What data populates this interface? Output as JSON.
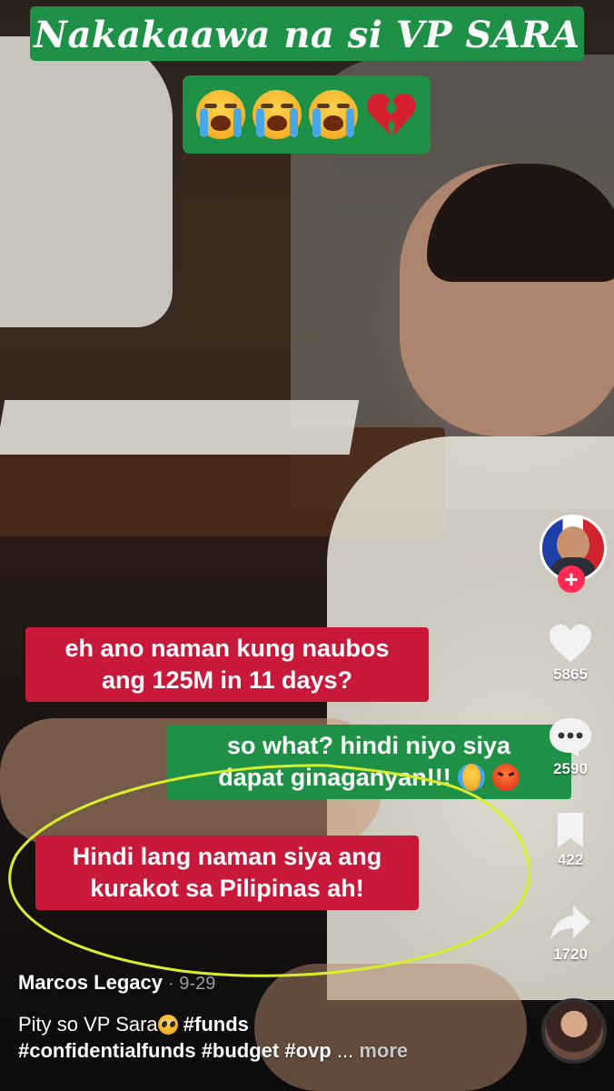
{
  "overlay": {
    "title": "Nakakaawa na si VP SARA",
    "title_bg": "#1f9146",
    "emoji_row": [
      "loudly-crying-face",
      "loudly-crying-face",
      "loudly-crying-face",
      "broken-heart"
    ]
  },
  "captions": {
    "c1_line1": "eh ano naman kung naubos",
    "c1_line2": "ang 125M in 11 days?",
    "c2_line1": "so what? hindi niyo siya",
    "c2_line2": "dapat ginaganyan!!!",
    "c3_line1": "Hindi lang naman siya ang",
    "c3_line2": "kurakot sa Pilipinas ah!",
    "red": "#c8193a",
    "green": "#1f9146",
    "annotation_color": "#d8ee2a"
  },
  "rail": {
    "likes": "5865",
    "comments": "2590",
    "saves": "422",
    "shares": "1720",
    "follow_symbol": "+",
    "follow_color": "#fe2c55"
  },
  "post": {
    "creator": "Marcos Legacy",
    "date": "· 9-29",
    "desc_text": "Pity so VP Sara",
    "hashtags_line1": [
      "#funds"
    ],
    "hashtags_line2": [
      "#confidentialfunds",
      "#budget",
      "#ovp"
    ],
    "ellipsis": "...",
    "more": "more"
  }
}
